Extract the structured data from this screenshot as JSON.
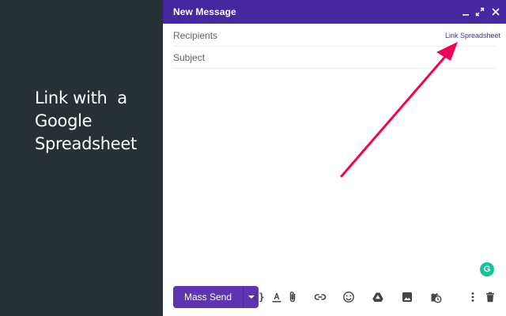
{
  "promo": {
    "lines": [
      "Link with  a",
      "Google",
      "Spreadsheet"
    ]
  },
  "compose": {
    "title": "New Message",
    "fields": {
      "recipients_placeholder": "Recipients",
      "subject_placeholder": "Subject"
    },
    "link_spreadsheet_label": "Link Spreadsheet",
    "send_button_label": "Mass Send",
    "toolbar_icons": [
      "template-braces-icon",
      "text-format-icon",
      "attach-icon",
      "link-icon",
      "emoji-icon",
      "drive-icon",
      "photo-icon",
      "schedule-icon",
      "more-options-icon",
      "delete-icon"
    ],
    "header_icons": [
      "minimize-icon",
      "fullscreen-icon",
      "close-icon"
    ]
  },
  "colors": {
    "header": "#4527a0",
    "button": "#5e35b1",
    "promo_background": "#263035",
    "arrow": "#f50057",
    "grammarly": "#15c39a"
  },
  "grammarly_badge": "G"
}
